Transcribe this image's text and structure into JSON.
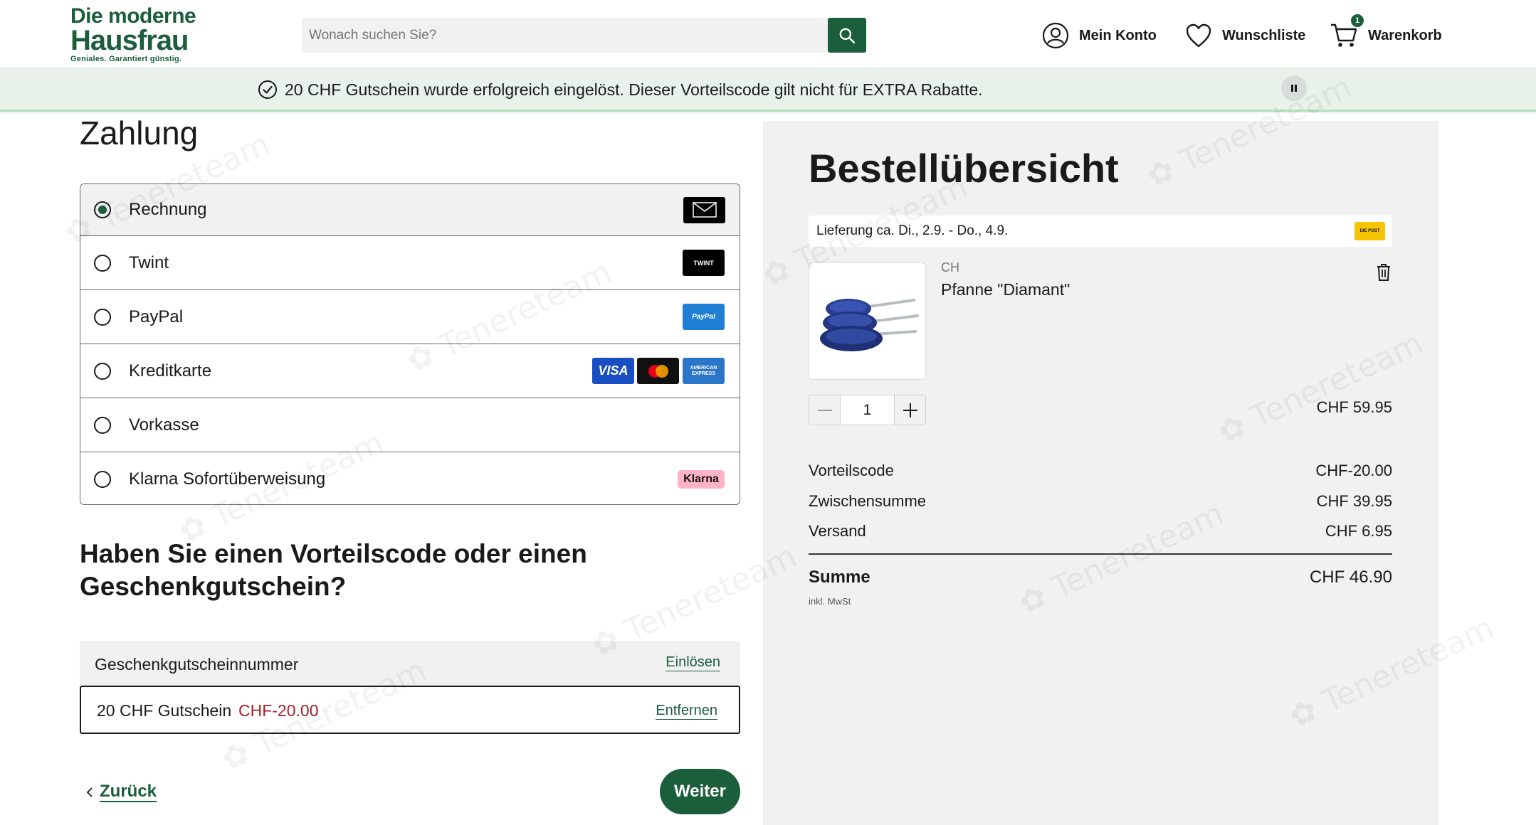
{
  "header": {
    "logo": {
      "line1": "Die moderne",
      "line2": "Hausfrau",
      "tagline": "Geniales. Garantiert günstig."
    },
    "search": {
      "placeholder": "Wonach suchen Sie?"
    },
    "nav": {
      "account_label": "Mein Konto",
      "wishlist_label": "Wunschliste",
      "cart_label": "Warenkorb",
      "cart_count": "1"
    }
  },
  "banner": {
    "message": "20 CHF Gutschein wurde erfolgreich eingelöst. Dieser Vorteilscode gilt nicht für EXTRA Rabatte."
  },
  "payment": {
    "title": "Zahlung",
    "methods": [
      {
        "label": "Rechnung",
        "selected": true,
        "logos": [
          "mail-icon"
        ]
      },
      {
        "label": "Twint",
        "selected": false,
        "logos": [
          "twint-logo"
        ]
      },
      {
        "label": "PayPal",
        "selected": false,
        "logos": [
          "paypal-logo"
        ]
      },
      {
        "label": "Kreditkarte",
        "selected": false,
        "logos": [
          "visa-logo",
          "mastercard-logo",
          "amex-logo"
        ]
      },
      {
        "label": "Vorkasse",
        "selected": false,
        "logos": []
      },
      {
        "label": "Klarna Sofortüberweisung",
        "selected": false,
        "logos": [
          "klarna-logo"
        ]
      }
    ],
    "logo_text": {
      "twint": "TWINT",
      "paypal": "PayPal",
      "visa": "VISA",
      "amex": "AMERICAN EXPRESS",
      "klarna": "Klarna"
    }
  },
  "voucher": {
    "title": "Haben Sie einen Vorteilscode oder einen Geschenkgutschein?",
    "input_label": "Geschenkgutscheinnummer",
    "redeem_label": "Einlösen",
    "applied_name": "20 CHF Gutschein",
    "applied_amount": "CHF-20.00",
    "remove_label": "Entfernen"
  },
  "footer_nav": {
    "back_label": "Zurück",
    "next_label": "Weiter"
  },
  "summary": {
    "title": "Bestellübersicht",
    "delivery": "Lieferung ca. Di., 2.9. - Do., 4.9.",
    "post_logo_text": "DIE POST",
    "product": {
      "country": "CH",
      "name": "Pfanne \"Diamant\"",
      "quantity": "1",
      "price": "CHF 59.95"
    },
    "lines": [
      {
        "label": "Vorteilscode",
        "value": "CHF-20.00"
      },
      {
        "label": "Zwischensumme",
        "value": "CHF 39.95"
      },
      {
        "label": "Versand",
        "value": "CHF 6.95"
      }
    ],
    "total_label": "Summe",
    "total_value": "CHF 46.90",
    "tax_note": "inkl. MwSt"
  },
  "colors": {
    "brand": "#1b5e3b",
    "banner_bg": "#e8f1ea",
    "discount_red": "#a3202a",
    "panel_bg": "#f1f1f1"
  }
}
